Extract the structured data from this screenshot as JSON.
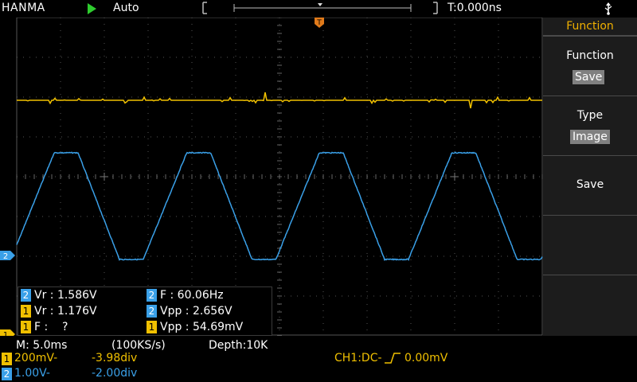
{
  "header": {
    "brand": "HANMA",
    "run_mode": "Auto",
    "trigger_time": "T:0.000ns"
  },
  "colors": {
    "ch1": "#f0c000",
    "ch2": "#3aa0e8",
    "menu_title": "#f0b000",
    "menu_value_bg": "#808080"
  },
  "measurements": {
    "rows": [
      [
        {
          "ch": "2",
          "label": "Vr : 1.586V"
        },
        {
          "ch": "2",
          "label": "F : 60.06Hz"
        }
      ],
      [
        {
          "ch": "1",
          "label": "Vr : 1.176V"
        },
        {
          "ch": "2",
          "label": "Vpp : 2.656V"
        }
      ],
      [
        {
          "ch": "1",
          "label": "F :    ?"
        },
        {
          "ch": "1",
          "label": "Vpp : 54.69mV"
        }
      ]
    ]
  },
  "markers": {
    "trigger_marker": "T",
    "ch2_marker": "2",
    "ch1_marker": "1"
  },
  "menu": {
    "title": "Function",
    "sections": [
      {
        "label": "Function",
        "value": "Save"
      },
      {
        "label": "Type",
        "value": "Image"
      },
      {
        "label": "Save",
        "value": ""
      }
    ]
  },
  "status": {
    "timebase": "M: 5.0ms",
    "sample_rate": "(100KS/s)",
    "depth": "Depth:10K",
    "ch1_scale": "200mV-",
    "ch1_offset": "-3.98div",
    "ch2_scale": "1.00V-",
    "ch2_offset": "-2.00div",
    "trigger": "CH1:DC-",
    "trigger_level": "0.00mV",
    "ch1_label": "1",
    "ch2_label": "2"
  },
  "chart_data": {
    "type": "line",
    "series": [
      {
        "name": "CH1",
        "color": "#f0c000",
        "shape": "flat line with small noise spikes"
      },
      {
        "name": "CH2",
        "color": "#3aa0e8",
        "shape": "trapezoidal wave, 4 cycles visible",
        "frequency_hz": 60.06,
        "vpp_v": 2.656
      }
    ],
    "timebase": "5.0ms/div",
    "grid": true
  }
}
